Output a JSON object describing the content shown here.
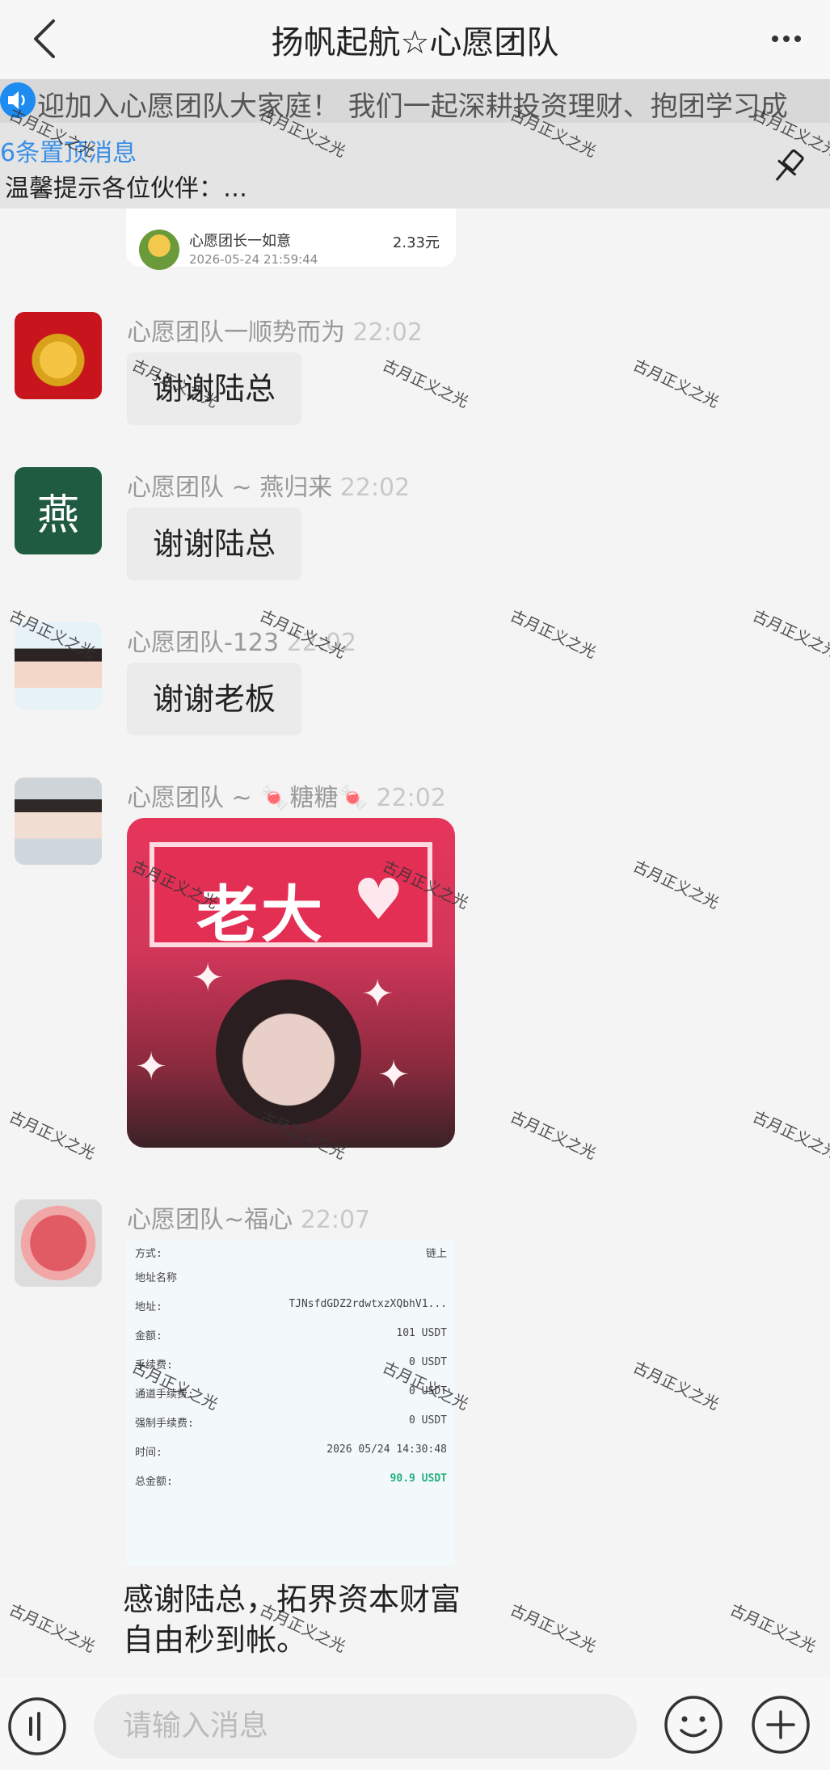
{
  "header": {
    "title": "扬帆起航☆心愿团队",
    "back_icon": "chevron-left-icon",
    "more_icon": "more-dots-icon"
  },
  "marquee": {
    "text": "迎加入心愿团队大家庭！     我们一起深耕投资理财、抱团学习成"
  },
  "pinned": {
    "count_label": "6条置顶消息",
    "preview": "温馨提示各位伙伴：…"
  },
  "redpacket": {
    "name": "心愿团长一如意",
    "time": "2026-05-24 21:59:44",
    "amount": "2.33元"
  },
  "messages": [
    {
      "sender": "心愿团队一顺势而为",
      "time": "22:02",
      "text": "谢谢陆总"
    },
    {
      "sender": "心愿团队 ~ 燕归来",
      "time": "22:02",
      "text": "谢谢陆总",
      "avatar_char": "燕"
    },
    {
      "sender": "心愿团队-123",
      "time": "22:02",
      "text": "谢谢老板"
    },
    {
      "sender": "心愿团队 ~ 🍬糖糖🍬",
      "time": "22:02",
      "sticker_text": "老大"
    },
    {
      "sender": "心愿团队~福心",
      "time": "22:07",
      "receipt": {
        "rows": [
          {
            "k": "方式:",
            "v": "链上"
          },
          {
            "k": "地址名称",
            "v": ""
          },
          {
            "k": "地址:",
            "v": "TJNsfdGDZ2rdwtxzXQbhV1..."
          },
          {
            "k": "金额:",
            "v": "101 USDT"
          },
          {
            "k": "手续费:",
            "v": "0 USDT"
          },
          {
            "k": "通道手续费:",
            "v": "0 USDT"
          },
          {
            "k": "强制手续费:",
            "v": "0 USDT"
          },
          {
            "k": "时间:",
            "v": "2026 05/24 14:30:48"
          },
          {
            "k": "总金额:",
            "v": "90.9 USDT"
          }
        ]
      },
      "caption": "感谢陆总，拓界资本财富自由秒到帐。"
    }
  ],
  "watermark": "古月正义之光",
  "input": {
    "placeholder": "请输入消息"
  },
  "colors": {
    "accent": "#3a8ee6",
    "bubble": "#ebebeb",
    "background": "#f4f4f4"
  }
}
